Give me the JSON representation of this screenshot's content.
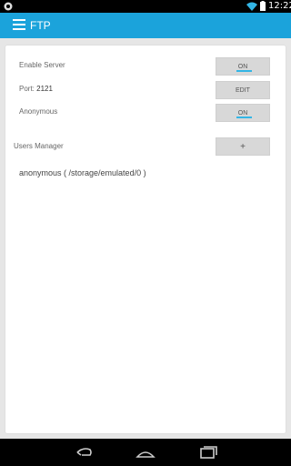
{
  "status_bar": {
    "time": "12:22"
  },
  "action_bar": {
    "title": "FTP"
  },
  "settings": {
    "enable_server": {
      "label": "Enable Server",
      "button": "ON"
    },
    "port": {
      "label": "Port:",
      "value": "2121",
      "button": "EDIT"
    },
    "anonymous": {
      "label": "Anonymous",
      "button": "ON"
    },
    "users_manager": {
      "label": "Users Manager",
      "button": "+"
    }
  },
  "users": [
    {
      "text": "anonymous ( /storage/emulated/0 )"
    }
  ],
  "colors": {
    "accent": "#1ba3db",
    "toggle_on": "#33b5e5"
  }
}
